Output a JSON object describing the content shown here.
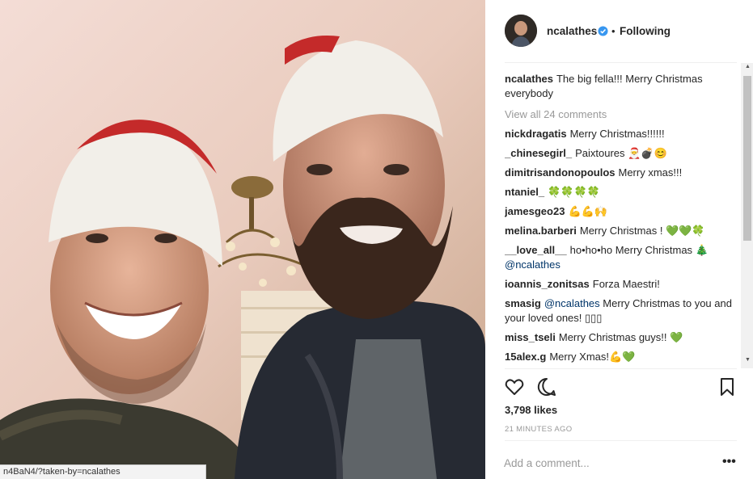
{
  "post": {
    "username": "ncalathes",
    "follow_status": "Following",
    "separator": "•",
    "caption": {
      "user": "ncalathes",
      "text": "The big fella!!! Merry Christmas everybody"
    },
    "view_all_comments": "View all 24 comments",
    "comments": [
      {
        "user": "nickdragatis",
        "text": "Merry Christmas!!!!!!"
      },
      {
        "user": "_chinesegirl_",
        "text": "Paixtoures 🎅💣😊"
      },
      {
        "user": "dimitrisandonopoulos",
        "text": "Merry xmas!!!"
      },
      {
        "user": "ntaniel_",
        "text": "🍀🍀🍀🍀"
      },
      {
        "user": "jamesgeo23",
        "text": "💪💪🙌"
      },
      {
        "user": "melina.barberi",
        "text": "Merry Christmas ! 💚💚🍀"
      },
      {
        "user": "__love_all__",
        "text": "ho•ho•ho Merry Christmas 🎄",
        "mention": "@ncalathes"
      },
      {
        "user": "ioannis_zonitsas",
        "text": "Forza Maestri!"
      },
      {
        "user": "smasig",
        "mention": "@ncalathes",
        "text": "Merry Christmas to you and your loved ones! ▯▯▯"
      },
      {
        "user": "miss_tseli",
        "text": "Merry Christmas guys!! 💚"
      },
      {
        "user": "15alex.g",
        "text": "Merry Xmas!💪💚"
      }
    ],
    "likes": "3,798 likes",
    "time_ago": "21 MINUTES AGO",
    "add_comment_placeholder": "Add a comment...",
    "more_label": "•••"
  },
  "status_bar_url": "n4BaN4/?taken-by=ncalathes",
  "icons": {
    "verified": "verified-badge-icon",
    "like": "heart-icon",
    "comment": "comment-bubble-icon",
    "save": "bookmark-icon"
  },
  "colors": {
    "verified": "#3897f0",
    "mention": "#003569",
    "muted": "#999999"
  }
}
